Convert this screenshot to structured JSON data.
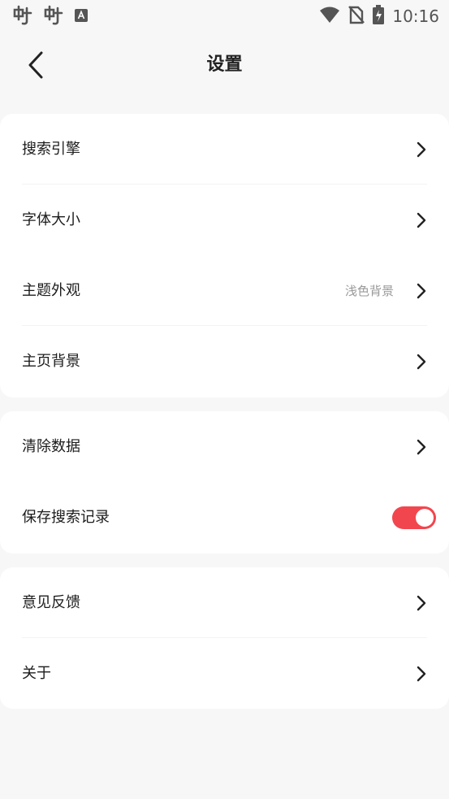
{
  "status_bar": {
    "time": "10:16",
    "icons": [
      "app-icon-1",
      "app-icon-2",
      "notification-a-icon",
      "wifi-icon",
      "no-sim-icon",
      "battery-charging-icon"
    ]
  },
  "header": {
    "title": "设置",
    "back_icon": "chevron-left-icon"
  },
  "groups": [
    {
      "items": [
        {
          "label": "搜索引擎",
          "value": "",
          "control": "chevron"
        },
        {
          "label": "字体大小",
          "value": "",
          "control": "chevron"
        },
        {
          "label": "主题外观",
          "value": "浅色背景",
          "control": "chevron"
        },
        {
          "label": "主页背景",
          "value": "",
          "control": "chevron"
        }
      ]
    },
    {
      "items": [
        {
          "label": "清除数据",
          "value": "",
          "control": "chevron"
        },
        {
          "label": "保存搜索记录",
          "control": "toggle",
          "toggle_on": true
        }
      ]
    },
    {
      "items": [
        {
          "label": "意见反馈",
          "value": "",
          "control": "chevron"
        },
        {
          "label": "关于",
          "value": "",
          "control": "chevron"
        }
      ]
    }
  ],
  "colors": {
    "background": "#f7f7f7",
    "card": "#ffffff",
    "toggle_on": "#f2464e",
    "secondary_text": "#9a9a9a"
  }
}
